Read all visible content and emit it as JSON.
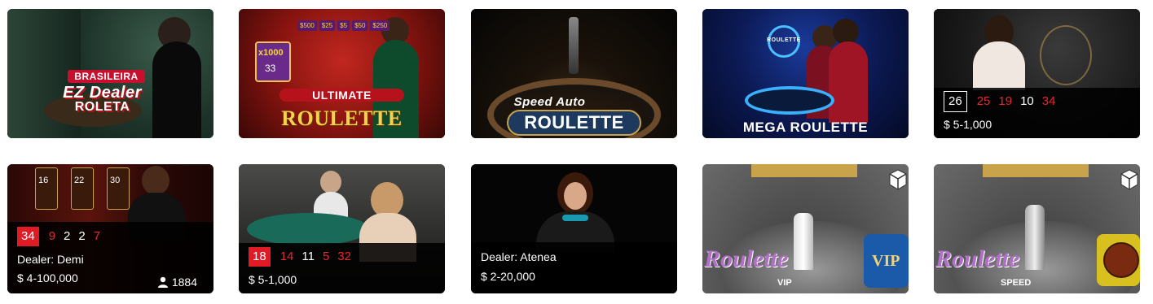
{
  "tiles": [
    {
      "title_line1": "BRASILEIRA",
      "title_line2": "EZ Dealer",
      "title_line3": "ROLETA"
    },
    {
      "title_line1": "ULTIMATE",
      "title_line2": "ROULETTE",
      "multipliers": [
        "x1000",
        "33"
      ],
      "bonus": [
        "$500",
        "$25",
        "$5",
        "$50",
        "$250"
      ]
    },
    {
      "title_line1": "Speed Auto",
      "title_line2": "ROULETTE"
    },
    {
      "title_line1": "ROULETTE",
      "title_line2": "MEGA ROULETTE"
    },
    {
      "results": [
        "26",
        "25",
        "19",
        "10",
        "34"
      ],
      "limits": "$ 5-1,000"
    },
    {
      "multipliers": [
        "16",
        "22",
        "30"
      ],
      "results": [
        "34",
        "9",
        "2",
        "2",
        "7"
      ],
      "dealer": "Dealer: Demi",
      "limits": "$ 4-100,000",
      "players": "1884"
    },
    {
      "results": [
        "18",
        "14",
        "11",
        "5",
        "32"
      ],
      "limits": "$ 5-1,000"
    },
    {
      "dealer": "Dealer: Atenea",
      "limits": "$ 2-20,000"
    },
    {
      "title_line1": "Roulette",
      "title_line2": "VIP",
      "badge": "VIP"
    },
    {
      "title_line1": "Roulette",
      "title_line2": "SPEED"
    }
  ],
  "colors": {
    "red": "#e8262e",
    "overlay": "#000000"
  }
}
